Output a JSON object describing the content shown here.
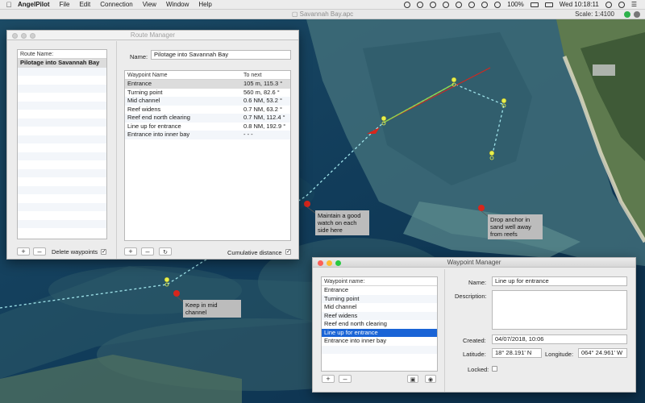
{
  "menubar": {
    "app_name": "AngelPilot",
    "menus": [
      "File",
      "Edit",
      "Connection",
      "View",
      "Window",
      "Help"
    ],
    "battery": "100%",
    "clock": "Wed 10:18:11"
  },
  "document": {
    "title": "Savannah Bay.apc",
    "scale": "Scale: 1:4100"
  },
  "map_notes": {
    "note1": "Maintain a good watch on each side here",
    "note2": "Drop anchor in sand well away from reefs",
    "note3": "Keep in mid channel"
  },
  "route_manager": {
    "title": "Route Manager",
    "route_list_header": "Route Name:",
    "routes": [
      "Pilotage into Savannah Bay"
    ],
    "name_label": "Name:",
    "name_value": "Pilotage into Savannah Bay",
    "col_waypoint": "Waypoint Name",
    "col_tonext": "To next",
    "waypoints": [
      {
        "name": "Entrance",
        "next": "105 m, 115.3 °"
      },
      {
        "name": "Turning point",
        "next": "560 m, 82.6 °"
      },
      {
        "name": "Mid channel",
        "next": "0.6 NM, 53.2 °"
      },
      {
        "name": "Reef widens",
        "next": "0.7 NM, 63.2 °"
      },
      {
        "name": "Reef end north clearing",
        "next": "0.7 NM, 112.4 °"
      },
      {
        "name": "Line up for entrance",
        "next": "0.8 NM, 192.9 °"
      },
      {
        "name": "Entrance into inner bay",
        "next": "- - -"
      }
    ],
    "add_label": "+",
    "remove_label": "–",
    "delete_waypoints_label": "Delete waypoints",
    "cumulative_label": "Cumulative distance",
    "check_mark": "✓"
  },
  "waypoint_manager": {
    "title": "Waypoint Manager",
    "list_header": "Waypoint name:",
    "items": [
      "Entrance",
      "Turning point",
      "Mid channel",
      "Reef widens",
      "Reef end north clearing",
      "Line up for entrance",
      "Entrance into inner bay"
    ],
    "selected_index": 5,
    "name_label": "Name:",
    "name_value": "Line up for entrance",
    "description_label": "Description:",
    "created_label": "Created:",
    "created_value": "04/07/2018, 10:06",
    "latitude_label": "Latitude:",
    "latitude_value": "18° 28.191' N",
    "longitude_label": "Longitude:",
    "longitude_value": "064° 24.961' W",
    "locked_label": "Locked:",
    "add_label": "+",
    "remove_label": "–"
  },
  "colors": {
    "water_deep": "#0f3a57",
    "route_line": "#9fe3ea",
    "waypoint_marker": "#e8f04a",
    "note_pin": "#d8261c",
    "selection_blue": "#1a64d6"
  }
}
